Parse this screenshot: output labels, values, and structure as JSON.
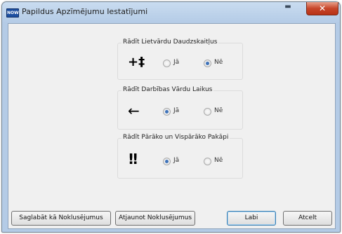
{
  "window": {
    "title": "Papildus Apzīmējumu Iestatījumi",
    "app_icon_text": "NOW"
  },
  "groups": [
    {
      "title": "Rādīt Lietvārdu Daudzskaitļus",
      "symbol": "+‡",
      "options": [
        {
          "label": "Jā",
          "selected": false
        },
        {
          "label": "Nē",
          "selected": true
        }
      ]
    },
    {
      "title": "Rādīt Darbības Vārdu Laikus",
      "symbol": "←",
      "options": [
        {
          "label": "Jā",
          "selected": true
        },
        {
          "label": "Nē",
          "selected": false
        }
      ]
    },
    {
      "title": "Rādīt Pārāko un Vispārāko Pakāpi",
      "symbol": "!!",
      "options": [
        {
          "label": "Jā",
          "selected": true
        },
        {
          "label": "Nē",
          "selected": false
        }
      ]
    }
  ],
  "buttons": {
    "save_default": "Saglabāt kā Noklusējumus",
    "restore_default": "Atjaunot Noklusējumus",
    "ok": "Labi",
    "cancel": "Atcelt"
  }
}
